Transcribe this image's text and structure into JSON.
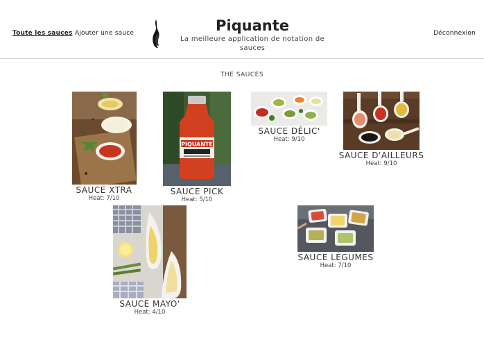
{
  "nav": {
    "all_sauces": "Toute les sauces",
    "add_sauce": "Ajouter une sauce",
    "logout": "Déconnexion"
  },
  "brand": {
    "title": "Piquante",
    "subtitle_line1": "La meilleure application de notation de",
    "subtitle_line2": "sauces",
    "logo_icon": "flame-icon"
  },
  "section_title": "THE SAUCES",
  "heat_label": "Heat:",
  "sauces": [
    {
      "name": "SAUCE XTRA",
      "heat": "7/10",
      "image": "sauce-bowls-wooden-board"
    },
    {
      "name": "SAUCE PICK",
      "heat": "5/10",
      "image": "piquante-sauce-bottle"
    },
    {
      "name": "SAUCE DÉLIC'",
      "heat": "9/10",
      "image": "sauce-bowls-with-herbs"
    },
    {
      "name": "SAUCE D'AILLEURS",
      "heat": "9/10",
      "image": "sauce-spoons-on-wood"
    },
    {
      "name": "SAUCE MAYO'",
      "heat": "4/10",
      "image": "mayonnaise-boats-asparagus"
    },
    {
      "name": "SAUCE LÉGUMES",
      "heat": "7/10",
      "image": "vegetable-sauce-square-bowls"
    }
  ],
  "colors": {
    "header_border": "#cfcfcf",
    "text": "#333333"
  }
}
